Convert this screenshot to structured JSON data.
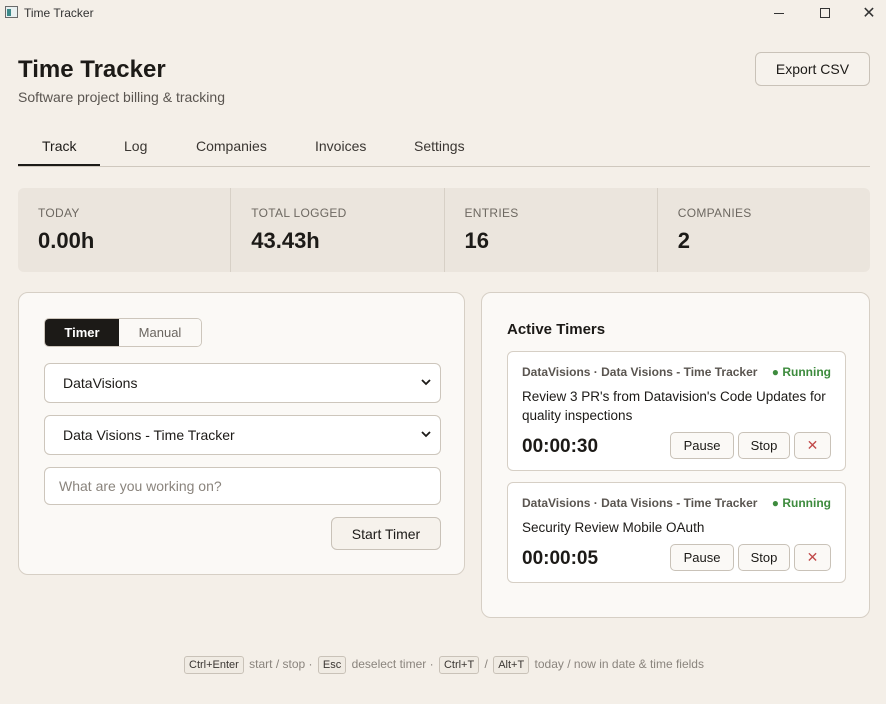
{
  "window": {
    "title": "Time Tracker",
    "close_glyph": "✕"
  },
  "header": {
    "title": "Time Tracker",
    "subtitle": "Software project billing & tracking",
    "export_label": "Export CSV"
  },
  "tabs": [
    {
      "label": "Track",
      "active": true
    },
    {
      "label": "Log",
      "active": false
    },
    {
      "label": "Companies",
      "active": false
    },
    {
      "label": "Invoices",
      "active": false
    },
    {
      "label": "Settings",
      "active": false
    }
  ],
  "stats": [
    {
      "label": "TODAY",
      "value": "0.00h"
    },
    {
      "label": "TOTAL LOGGED",
      "value": "43.43h"
    },
    {
      "label": "ENTRIES",
      "value": "16"
    },
    {
      "label": "COMPANIES",
      "value": "2"
    }
  ],
  "form": {
    "mode_timer": "Timer",
    "mode_manual": "Manual",
    "company_selected": "DataVisions",
    "project_selected": "Data Visions - Time Tracker",
    "description_placeholder": "What are you working on?",
    "start_label": "Start Timer"
  },
  "active_timers": {
    "title": "Active Timers",
    "items": [
      {
        "meta": "DataVisions · Data Visions - Time Tracker",
        "status": "● Running",
        "description": "Review 3 PR's from Datavision's Code Updates for quality inspections",
        "elapsed": "00:00:30",
        "pause_label": "Pause",
        "stop_label": "Stop",
        "delete_glyph": "✕"
      },
      {
        "meta": "DataVisions · Data Visions - Time Tracker",
        "status": "● Running",
        "description": "Security Review Mobile OAuth",
        "elapsed": "00:00:05",
        "pause_label": "Pause",
        "stop_label": "Stop",
        "delete_glyph": "✕"
      }
    ]
  },
  "footer": {
    "key1": "Ctrl+Enter",
    "text1": "start / stop ·",
    "key2": "Esc",
    "text2": "deselect timer ·",
    "key3": "Ctrl+T",
    "text3": "/",
    "key4": "Alt+T",
    "text4": "today / now in date & time fields"
  },
  "colors": {
    "background": "#f4efe8",
    "accent_dark": "#1c1a17",
    "running_green": "#3d8b3d",
    "delete_red": "#c14a4a"
  }
}
